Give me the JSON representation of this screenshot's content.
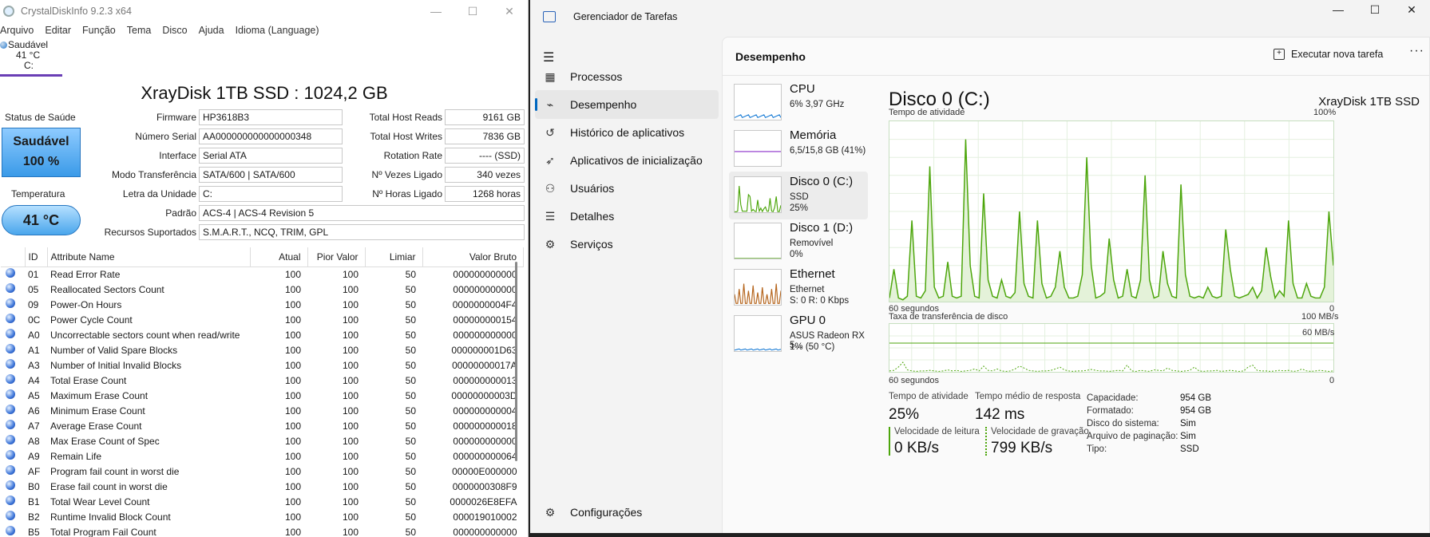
{
  "cdi": {
    "window_title": "CrystalDiskInfo 9.2.3 x64",
    "menu": [
      "Arquivo",
      "Editar",
      "Função",
      "Tema",
      "Disco",
      "Ajuda",
      "Idioma (Language)"
    ],
    "drive_tab": {
      "status": "Saudável",
      "temp": "41 °C",
      "letter": "C:"
    },
    "model": "XrayDisk 1TB SSD : 1024,2 GB",
    "health_label": "Status de Saúde",
    "health_status": "Saudável",
    "health_percent": "100 %",
    "temp_label": "Temperatura",
    "temp_value": "41 °C",
    "fields": {
      "firmware": {
        "label": "Firmware",
        "value": "HP3618B3"
      },
      "serial": {
        "label": "Número Serial",
        "value": "AA000000000000000348"
      },
      "interface": {
        "label": "Interface",
        "value": "Serial ATA"
      },
      "transfer": {
        "label": "Modo Transferência",
        "value": "SATA/600 | SATA/600"
      },
      "letter": {
        "label": "Letra da Unidade",
        "value": "C:"
      },
      "standard": {
        "label": "Padrão",
        "value": "ACS-4 | ACS-4 Revision 5"
      },
      "features": {
        "label": "Recursos Suportados",
        "value": "S.M.A.R.T., NCQ, TRIM, GPL"
      },
      "host_reads": {
        "label": "Total Host Reads",
        "value": "9161 GB"
      },
      "host_writes": {
        "label": "Total Host Writes",
        "value": "7836 GB"
      },
      "rotation": {
        "label": "Rotation Rate",
        "value": "---- (SSD)"
      },
      "power_count": {
        "label": "Nº Vezes Ligado",
        "value": "340 vezes"
      },
      "power_hours": {
        "label": "Nº Horas Ligado",
        "value": "1268 horas"
      }
    },
    "table_headers": [
      "ID",
      "Attribute Name",
      "Atual",
      "Pior Valor",
      "Limiar",
      "Valor Bruto"
    ],
    "attributes": [
      [
        "01",
        "Read Error Rate",
        "100",
        "100",
        "50",
        "000000000000"
      ],
      [
        "05",
        "Reallocated Sectors Count",
        "100",
        "100",
        "50",
        "000000000000"
      ],
      [
        "09",
        "Power-On Hours",
        "100",
        "100",
        "50",
        "0000000004F4"
      ],
      [
        "0C",
        "Power Cycle Count",
        "100",
        "100",
        "50",
        "000000000154"
      ],
      [
        "A0",
        "Uncorrectable sectors count when read/write",
        "100",
        "100",
        "50",
        "000000000000"
      ],
      [
        "A1",
        "Number of Valid Spare Blocks",
        "100",
        "100",
        "50",
        "000000001D63"
      ],
      [
        "A3",
        "Number of Initial Invalid Blocks",
        "100",
        "100",
        "50",
        "00000000017A"
      ],
      [
        "A4",
        "Total Erase Count",
        "100",
        "100",
        "50",
        "000000000013"
      ],
      [
        "A5",
        "Maximum Erase Count",
        "100",
        "100",
        "50",
        "00000000003D"
      ],
      [
        "A6",
        "Minimum Erase Count",
        "100",
        "100",
        "50",
        "000000000004"
      ],
      [
        "A7",
        "Average Erase Count",
        "100",
        "100",
        "50",
        "000000000018"
      ],
      [
        "A8",
        "Max Erase Count of Spec",
        "100",
        "100",
        "50",
        "000000000000"
      ],
      [
        "A9",
        "Remain Life",
        "100",
        "100",
        "50",
        "000000000064"
      ],
      [
        "AF",
        "Program fail count in worst die",
        "100",
        "100",
        "50",
        "00000E000000"
      ],
      [
        "B0",
        "Erase fail count in worst die",
        "100",
        "100",
        "50",
        "0000000308F9"
      ],
      [
        "B1",
        "Total Wear Level Count",
        "100",
        "100",
        "50",
        "0000026E8EFA"
      ],
      [
        "B2",
        "Runtime Invalid Block Count",
        "100",
        "100",
        "50",
        "000019010002"
      ],
      [
        "B5",
        "Total Program Fail Count",
        "100",
        "100",
        "50",
        "000000000000"
      ]
    ]
  },
  "tm": {
    "window_title": "Gerenciador de Tarefas",
    "nav": [
      {
        "icon": "processes-icon",
        "glyph": "▦",
        "label": "Processos"
      },
      {
        "icon": "performance-icon",
        "glyph": "⌁",
        "label": "Desempenho"
      },
      {
        "icon": "app-history-icon",
        "glyph": "↺",
        "label": "Histórico de aplicativos"
      },
      {
        "icon": "startup-apps-icon",
        "glyph": "➶",
        "label": "Aplicativos de inicialização"
      },
      {
        "icon": "users-icon",
        "glyph": "⚇",
        "label": "Usuários"
      },
      {
        "icon": "details-icon",
        "glyph": "☰",
        "label": "Detalhes"
      },
      {
        "icon": "services-icon",
        "glyph": "⚙",
        "label": "Serviços"
      }
    ],
    "settings_label": "Configurações",
    "header": "Desempenho",
    "new_task": "Executar nova tarefa",
    "cards": [
      {
        "name": "CPU",
        "line1": "6% 3,97 GHz",
        "line2": ""
      },
      {
        "name": "Memória",
        "line1": "6,5/15,8 GB (41%)",
        "line2": ""
      },
      {
        "name": "Disco 0 (C:)",
        "line1": "SSD",
        "line2": "25%"
      },
      {
        "name": "Disco 1 (D:)",
        "line1": "Removível",
        "line2": "0%"
      },
      {
        "name": "Ethernet",
        "line1": "Ethernet",
        "line2": "S: 0 R: 0 Kbps"
      },
      {
        "name": "GPU 0",
        "line1": "ASUS Radeon RX 5...",
        "line2": "1% (50 °C)"
      }
    ],
    "disk_title": "Disco 0 (C:)",
    "disk_model": "XrayDisk 1TB SSD",
    "chart1": {
      "label": "Tempo de atividade",
      "max": "100%",
      "xleft": "60 segundos",
      "xright": "0"
    },
    "chart2": {
      "label": "Taxa de transferência de disco",
      "max": "100 MB/s",
      "ref": "60 MB/s",
      "xleft": "60 segundos",
      "xright": "0"
    },
    "activity_values": [
      2,
      18,
      2,
      1,
      3,
      45,
      3,
      2,
      6,
      75,
      8,
      2,
      3,
      22,
      3,
      2,
      3,
      90,
      20,
      3,
      2,
      60,
      12,
      3,
      2,
      12,
      3,
      2,
      5,
      50,
      10,
      3,
      2,
      45,
      10,
      2,
      3,
      8,
      28,
      8,
      2,
      2,
      3,
      15,
      80,
      20,
      2,
      3,
      5,
      35,
      12,
      2,
      3,
      18,
      3,
      2,
      12,
      70,
      12,
      2,
      3,
      28,
      10,
      3,
      2,
      65,
      15,
      3,
      2,
      3,
      2,
      8,
      3,
      2,
      3,
      40,
      18,
      3,
      2,
      3,
      4,
      8,
      2,
      6,
      30,
      14,
      2,
      6,
      3,
      45,
      10,
      2,
      2,
      10,
      3,
      2,
      2,
      8,
      50,
      20
    ],
    "transfer_values": [
      2,
      3,
      10,
      20,
      4,
      2,
      1,
      2,
      2,
      3,
      2,
      1,
      2,
      4,
      2,
      3,
      1,
      2,
      3,
      6,
      2,
      12,
      3,
      2,
      6,
      2,
      1,
      2,
      6,
      12,
      8,
      3,
      2,
      1,
      2,
      2,
      3,
      6,
      10,
      4,
      2,
      1,
      2,
      2,
      3,
      5,
      3,
      2,
      2,
      1,
      2,
      3,
      2,
      14,
      2,
      1,
      3,
      2,
      1,
      4,
      3,
      2,
      8,
      3,
      2,
      1,
      2,
      3,
      10,
      2,
      1,
      2,
      2,
      3,
      1,
      2,
      3,
      2,
      1,
      2,
      10,
      14,
      3,
      2,
      2,
      1,
      2,
      3,
      2,
      3,
      1,
      2,
      6,
      2,
      1,
      2,
      3,
      2,
      1,
      2
    ],
    "stats": {
      "activity": {
        "label": "Tempo de atividade",
        "value": "25%"
      },
      "response": {
        "label": "Tempo médio de resposta",
        "value": "142 ms"
      },
      "read": {
        "label": "Velocidade de leitura",
        "value": "0 KB/s"
      },
      "write": {
        "label": "Velocidade de gravação",
        "value": "799 KB/s"
      }
    },
    "props": [
      [
        "Capacidade:",
        "954 GB"
      ],
      [
        "Formatado:",
        "954 GB"
      ],
      [
        "Disco do sistema:",
        "Sim"
      ],
      [
        "Arquivo de paginação:",
        "Sim"
      ],
      [
        "Tipo:",
        "SSD"
      ]
    ],
    "colors": {
      "accent": "#0067c0",
      "disk_green": "#4da60c",
      "fill_green": "#e4f2d9"
    }
  }
}
